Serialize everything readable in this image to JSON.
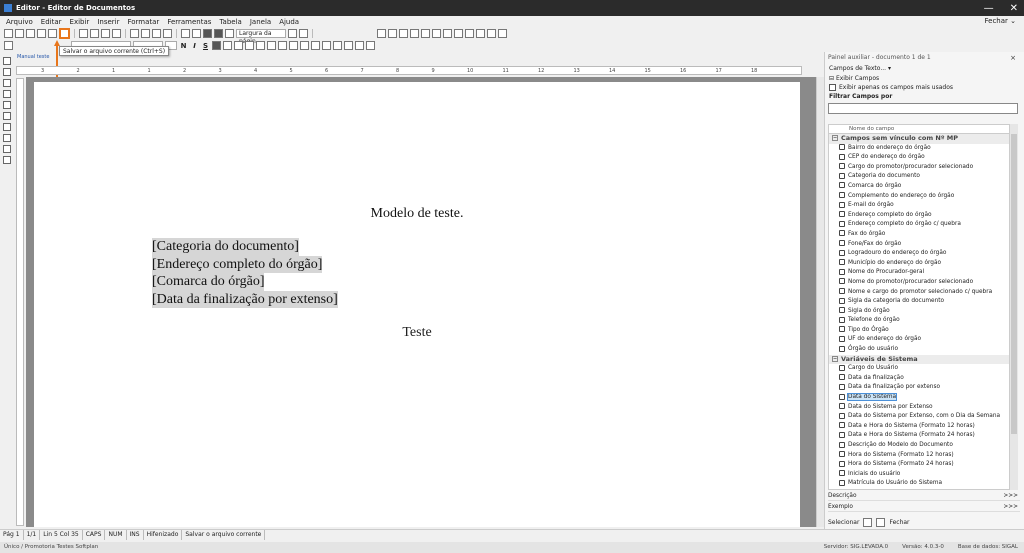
{
  "window": {
    "title": "Editor - Editor de Documentos",
    "minimize": "—",
    "close": "✕"
  },
  "menu": {
    "items": [
      "Arquivo",
      "Editar",
      "Exibir",
      "Inserir",
      "Formatar",
      "Ferramentas",
      "Tabela",
      "Janela",
      "Ajuda"
    ],
    "close_label": "Fechar"
  },
  "toolbar": {
    "style_combo": "",
    "width_combo": "Largura da págin",
    "font_combo": "",
    "size_combo": "",
    "tooltip": "Salvar o arquivo corrente (Ctrl+S)",
    "accent_color": "#e8761b"
  },
  "tabs": {
    "active": "Manual teste"
  },
  "ruler": {
    "numbers": [
      "3",
      "2",
      "1",
      "1",
      "2",
      "3",
      "4",
      "5",
      "6",
      "7",
      "8",
      "9",
      "10",
      "11",
      "12",
      "13",
      "14",
      "15",
      "16",
      "17",
      "18"
    ]
  },
  "document": {
    "title": "Modelo de teste.",
    "fields": [
      "[Categoria do documento]",
      "[Endereço completo do órgão]",
      "[Comarca do órgão]",
      "[Data da finalização por extenso]"
    ],
    "footer": "Teste"
  },
  "side_panel": {
    "title": "Painel auxiliar - documento 1 de 1",
    "close": "×",
    "selector": "Campos de Texto... ▾",
    "show_fields_label": "Exibir Campos",
    "only_used_label": "Exibir apenas os campos mais usados",
    "filter_label": "Filtrar Campos por",
    "column_header": "Nome do campo",
    "groups": [
      {
        "name": "Campos sem vínculo com Nº MP",
        "items": [
          "Bairro do endereço do órgão",
          "CEP do endereço do órgão",
          "Cargo do promotor/procurador selecionado",
          "Categoria do documento",
          "Comarca do órgão",
          "Complemento do endereço do órgão",
          "E-mail do órgão",
          "Endereço completo do órgão",
          "Endereço completo do órgão c/ quebra",
          "Fax do órgão",
          "Fone/Fax do órgão",
          "Logradouro do endereço do órgão",
          "Município do endereço do órgão",
          "Nome do Procurador-geral",
          "Nome do promotor/procurador selecionado",
          "Nome e cargo do promotor selecionado c/ quebra",
          "Sigla da categoria do documento",
          "Sigla do órgão",
          "Telefone do órgão",
          "Tipo do Órgão",
          "UF do endereço do órgão",
          "Órgão do usuário"
        ]
      },
      {
        "name": "Variáveis de Sistema",
        "items": [
          "Cargo do Usuário",
          "Data da finalização",
          "Data da finalização por extenso",
          "Data do Sistema",
          "Data do Sistema por Extenso",
          "Data do Sistema por Extenso, com o Dia da Semana",
          "Data e Hora do Sistema (Formato 12 horas)",
          "Data e Hora do Sistema (Formato 24 horas)",
          "Descrição do Modelo do Documento",
          "Hora do Sistema (Formato 12 horas)",
          "Hora do Sistema (Formato 24 horas)",
          "Iniciais do usuário",
          "Matrícula do Usuário do Sistema"
        ]
      }
    ],
    "selected_item": "Data do Sistema",
    "description_label": "Descrição",
    "example_label": "Exemplo",
    "more": ">>>",
    "select_label": "Selecionar",
    "close_label": "Fechar"
  },
  "status": {
    "page": "Pág 1",
    "pages": "1/1",
    "position": "Lin 5  Col 35",
    "caps": "CAPS",
    "num": "NUM",
    "ins": "INS",
    "hifenizado": "Hifenizado",
    "message": "Salvar o arquivo corrente"
  },
  "footer": {
    "left": "Único / Promotoria Testes Softplan",
    "server": "Servidor: SIG.LEVADA.0",
    "version": "Versão: 4.0.3-0",
    "database": "Base de dados: SIGAL"
  }
}
